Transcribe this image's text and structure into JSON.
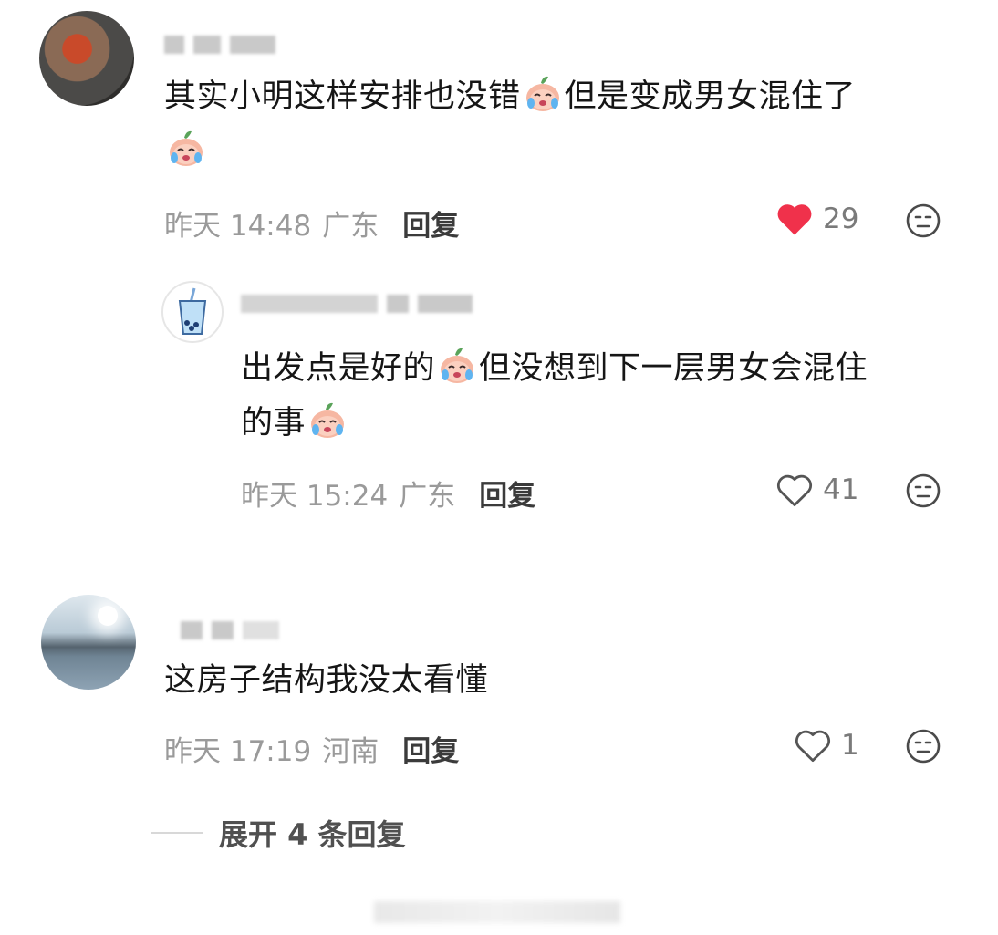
{
  "comments": [
    {
      "text_part1": "其实小明这样安排也没错",
      "text_part2": "但是变成男女混住了",
      "time": "昨天 14:48",
      "location": "广东",
      "reply_label": "回复",
      "likes": "29",
      "liked": true
    },
    {
      "text_part1": "出发点是好的",
      "text_part2": "但没想到下一层男女会混住",
      "text_part3": "的事",
      "time": "昨天 15:24",
      "location": "广东",
      "reply_label": "回复",
      "likes": "41",
      "liked": false
    },
    {
      "text_part1": "这房子结构我没太看懂",
      "time": "昨天 17:19",
      "location": "河南",
      "reply_label": "回复",
      "likes": "1",
      "liked": false
    }
  ],
  "expand_replies": "展开 4 条回复",
  "colors": {
    "liked_heart": "#f0314b",
    "meta_gray": "#9a9a9a"
  },
  "icons": [
    "crying-emoji-icon",
    "heart-icon",
    "dislike-face-icon"
  ]
}
